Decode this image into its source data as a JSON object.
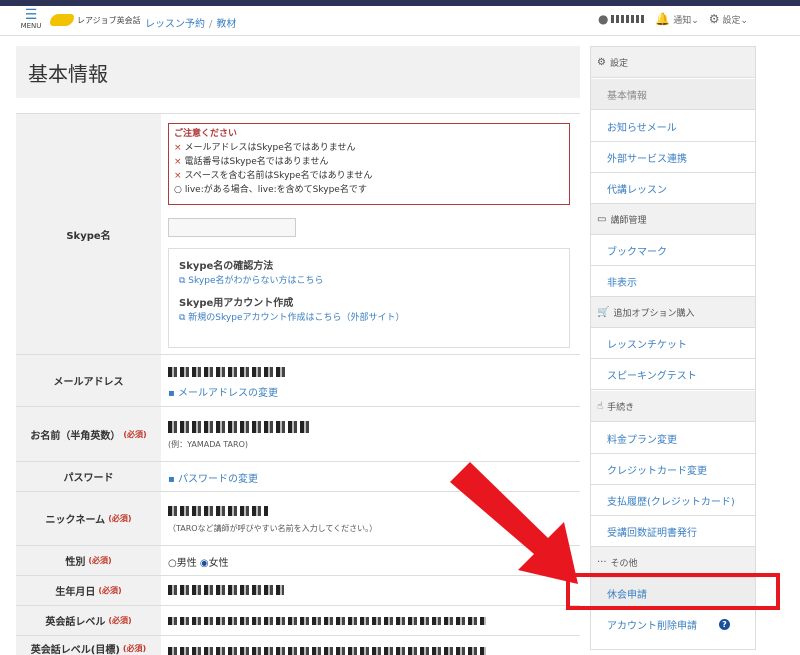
{
  "header": {
    "menu_label": "MENU",
    "logo_text": "レアジョブ英会話",
    "breadcrumb": [
      "レッスン予約",
      "教材"
    ],
    "notifications_label": "通知",
    "settings_label": "設定"
  },
  "page": {
    "title": "基本情報"
  },
  "form": {
    "skype": {
      "label": "Skype名",
      "notice_title": "ご注意ください",
      "notice_items": [
        "メールアドレスはSkype名ではありません",
        "電話番号はSkype名ではありません",
        "スペースを含む名前はSkype名ではありません",
        "live:がある場合、live:を含めてSkype名です"
      ],
      "notice_marks": [
        "×",
        "×",
        "×",
        "○"
      ],
      "help_title_1": "Skype名の確認方法",
      "help_link_1": "Skype名がわからない方はこちら",
      "help_title_2": "Skype用アカウント作成",
      "help_link_2": "新規のSkypeアカウント作成はこちら（外部サイト）"
    },
    "email": {
      "label": "メールアドレス",
      "change_link": "メールアドレスの変更"
    },
    "name": {
      "label": "お名前（半角英数）",
      "required": "(必須)",
      "hint": "(例：YAMADA TARO)"
    },
    "password": {
      "label": "パスワード",
      "change_link": "パスワードの変更"
    },
    "nickname": {
      "label": "ニックネーム",
      "required": "(必須)",
      "hint": "（TAROなど講師が呼びやすい名前を入力してください。）"
    },
    "gender": {
      "label": "性別",
      "required": "(必須)",
      "options": [
        "男性",
        "女性"
      ],
      "selected": "女性"
    },
    "birthday": {
      "label": "生年月日",
      "required": "(必須)"
    },
    "level": {
      "label": "英会話レベル",
      "required": "(必須)"
    },
    "level_goal": {
      "label": "英会話レベル(目標)",
      "required": "(必須)"
    }
  },
  "sidebar": {
    "sections": [
      {
        "title": "設定",
        "icon": "gear-icon",
        "items": [
          "基本情報",
          "お知らせメール",
          "外部サービス連携",
          "代講レッスン"
        ]
      },
      {
        "title": "講師管理",
        "icon": "folder-icon",
        "items": [
          "ブックマーク",
          "非表示"
        ]
      },
      {
        "title": "追加オプション購入",
        "icon": "cart-icon",
        "items": [
          "レッスンチケット",
          "スピーキングテスト"
        ]
      },
      {
        "title": "手続き",
        "icon": "thumbs-up-icon",
        "items": [
          "料金プラン変更",
          "クレジットカード変更",
          "支払履歴(クレジットカード)",
          "受講回数証明書発行"
        ]
      },
      {
        "title": "その他",
        "icon": "more-icon",
        "items": [
          "休会申請",
          "アカウント削除申請"
        ]
      }
    ],
    "active_item": "基本情報",
    "highlighted_item": "休会申請"
  },
  "colors": {
    "accent": "#3a7fc1",
    "required": "#c0392b",
    "highlight": "#e8171f",
    "topbar": "#2c3357"
  }
}
